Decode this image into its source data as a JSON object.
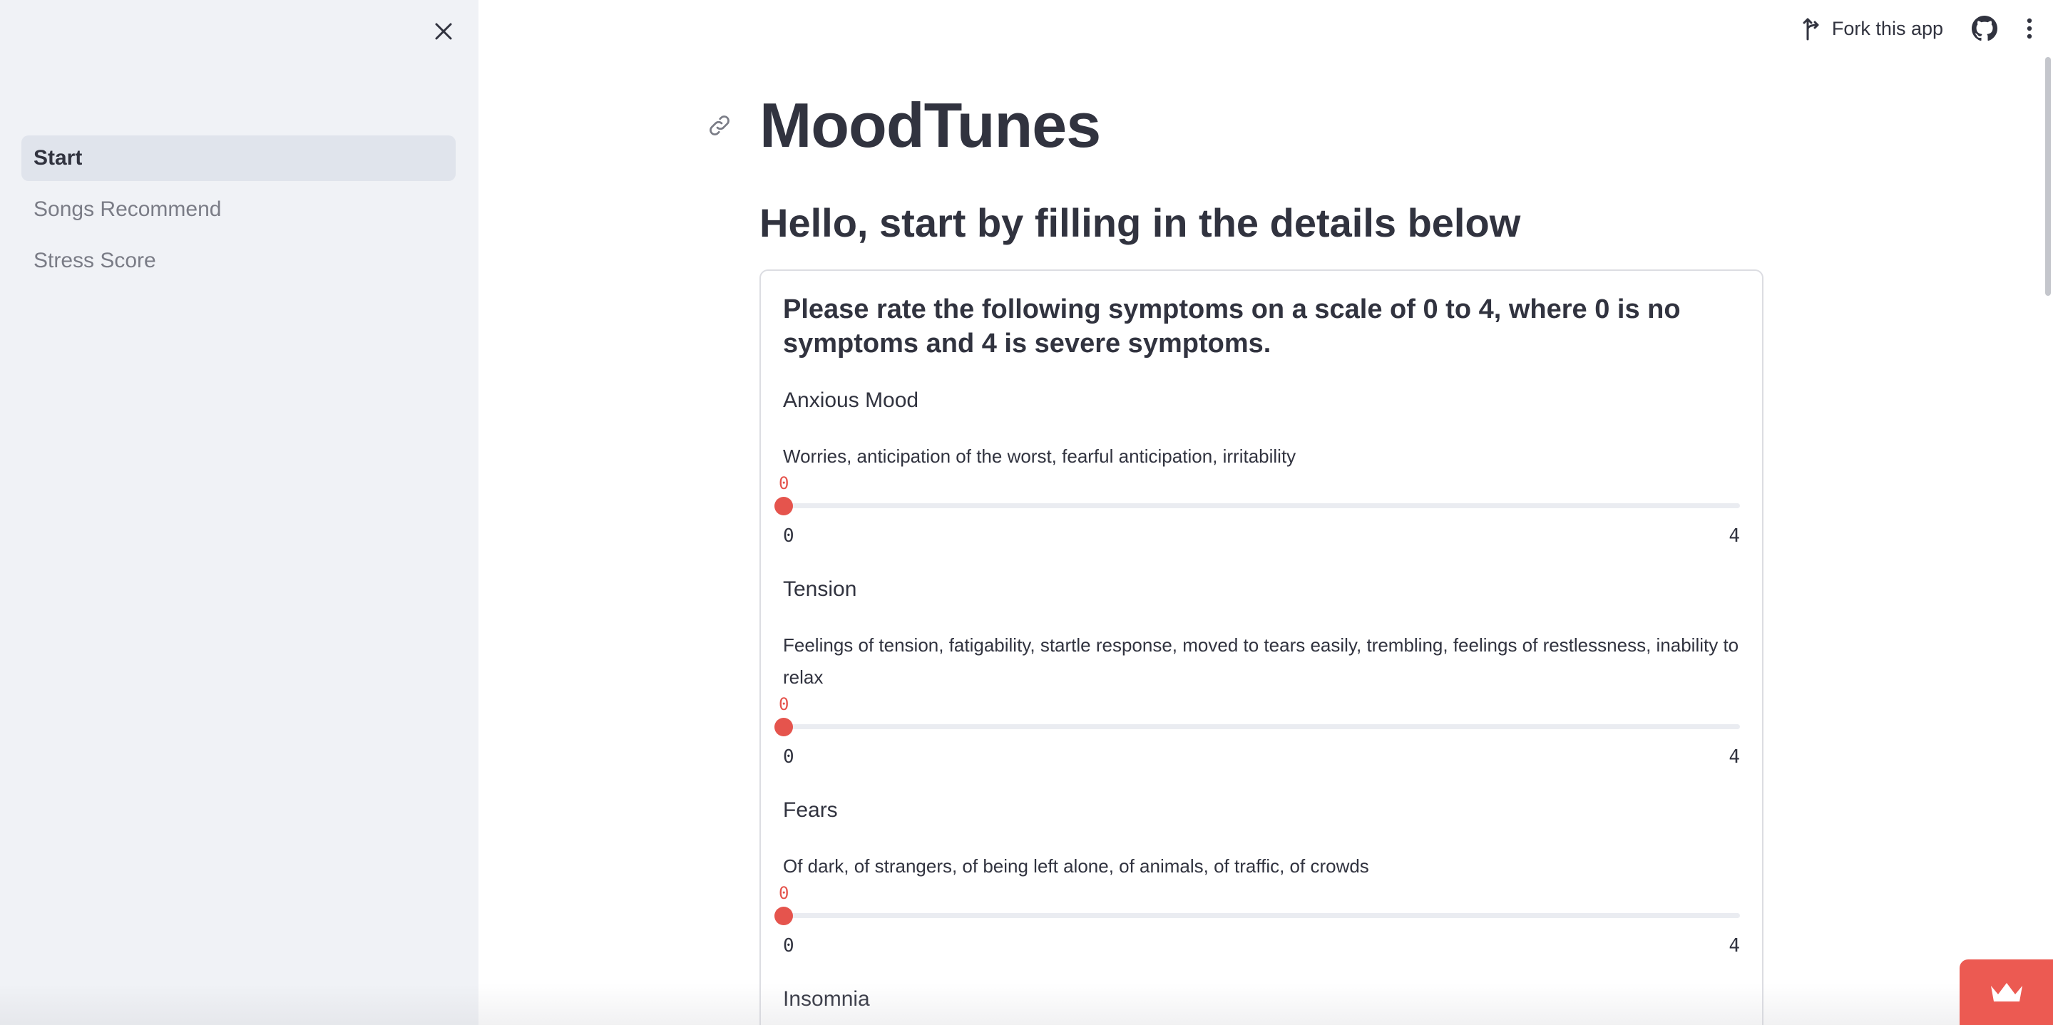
{
  "sidebar": {
    "items": [
      {
        "label": "Start"
      },
      {
        "label": "Songs Recommend"
      },
      {
        "label": "Stress Score"
      }
    ]
  },
  "header": {
    "fork_label": "Fork this app"
  },
  "main": {
    "title": "MoodTunes",
    "subtitle": "Hello, start by filling in the details below",
    "card_heading": "Please rate the following symptoms on a scale of 0 to 4, where 0 is no symptoms and 4 is severe symptoms.",
    "symptoms": [
      {
        "name": "Anxious Mood",
        "description": "Worries, anticipation of the worst, fearful anticipation, irritability",
        "value": "0",
        "min": "0",
        "max": "4"
      },
      {
        "name": "Tension",
        "description": "Feelings of tension, fatigability, startle response, moved to tears easily, trembling, feelings of restlessness, inability to relax",
        "value": "0",
        "min": "0",
        "max": "4"
      },
      {
        "name": "Fears",
        "description": "Of dark, of strangers, of being left alone, of animals, of traffic, of crowds",
        "value": "0",
        "min": "0",
        "max": "4"
      },
      {
        "name": "Insomnia"
      }
    ]
  },
  "colors": {
    "accent": "#e5544d",
    "sidebar_bg": "#f0f2f6",
    "text": "#31333f"
  },
  "icons": [
    "close-icon",
    "fork-icon",
    "github-icon",
    "kebab-menu-icon",
    "link-icon",
    "crown-icon"
  ]
}
